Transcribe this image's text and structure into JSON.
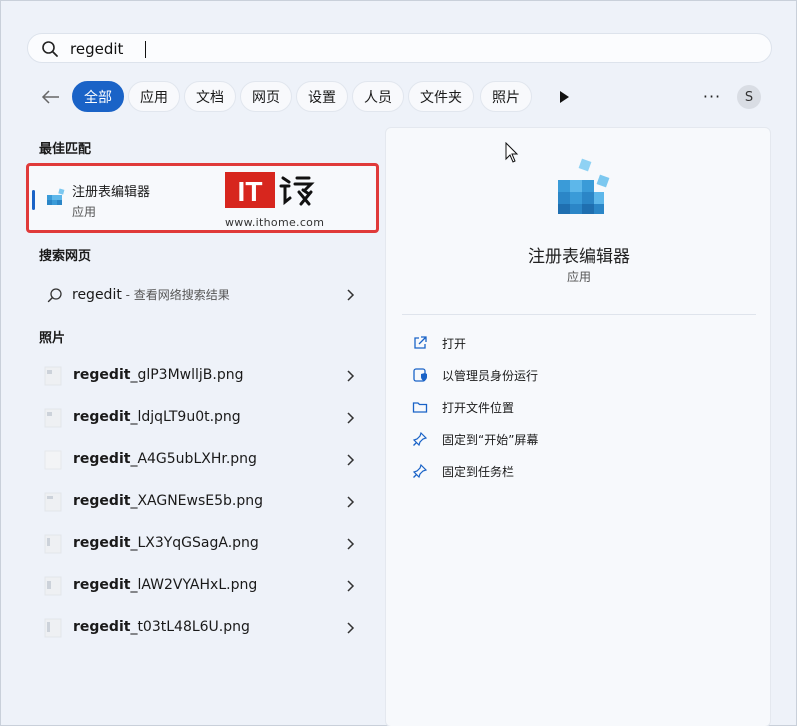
{
  "search": {
    "query": "regedit"
  },
  "filters": {
    "chips": [
      "全部",
      "应用",
      "文档",
      "网页",
      "设置",
      "人员",
      "文件夹",
      "照片"
    ],
    "more_label": "···",
    "avatar_initial": "S"
  },
  "best_match": {
    "section_title": "最佳匹配",
    "app_name": "注册表编辑器",
    "app_type": "应用",
    "watermark_url": "www.ithome.com"
  },
  "web": {
    "section_title": "搜索网页",
    "query": "regedit",
    "hint": " - 查看网络搜索结果"
  },
  "photos": {
    "section_title": "照片",
    "items": [
      {
        "bold": "regedit",
        "rest": "_glP3MwlljB.png"
      },
      {
        "bold": "regedit",
        "rest": "_ldjqLT9u0t.png"
      },
      {
        "bold": "regedit",
        "rest": "_A4G5ubLXHr.png"
      },
      {
        "bold": "regedit",
        "rest": "_XAGNEwsE5b.png"
      },
      {
        "bold": "regedit",
        "rest": "_LX3YqGSagA.png"
      },
      {
        "bold": "regedit",
        "rest": "_lAW2VYAHxL.png"
      },
      {
        "bold": "regedit",
        "rest": "_t03tL48L6U.png"
      }
    ]
  },
  "detail": {
    "title": "注册表编辑器",
    "subtitle": "应用",
    "actions": [
      {
        "label": "打开",
        "icon": "open-external-icon"
      },
      {
        "label": "以管理员身份运行",
        "icon": "shield-admin-icon"
      },
      {
        "label": "打开文件位置",
        "icon": "folder-icon"
      },
      {
        "label": "固定到“开始”屏幕",
        "icon": "pin-icon"
      },
      {
        "label": "固定到任务栏",
        "icon": "pin-icon"
      }
    ]
  },
  "colors": {
    "accent": "#1a63c7",
    "highlight_border": "#e03a3a"
  }
}
